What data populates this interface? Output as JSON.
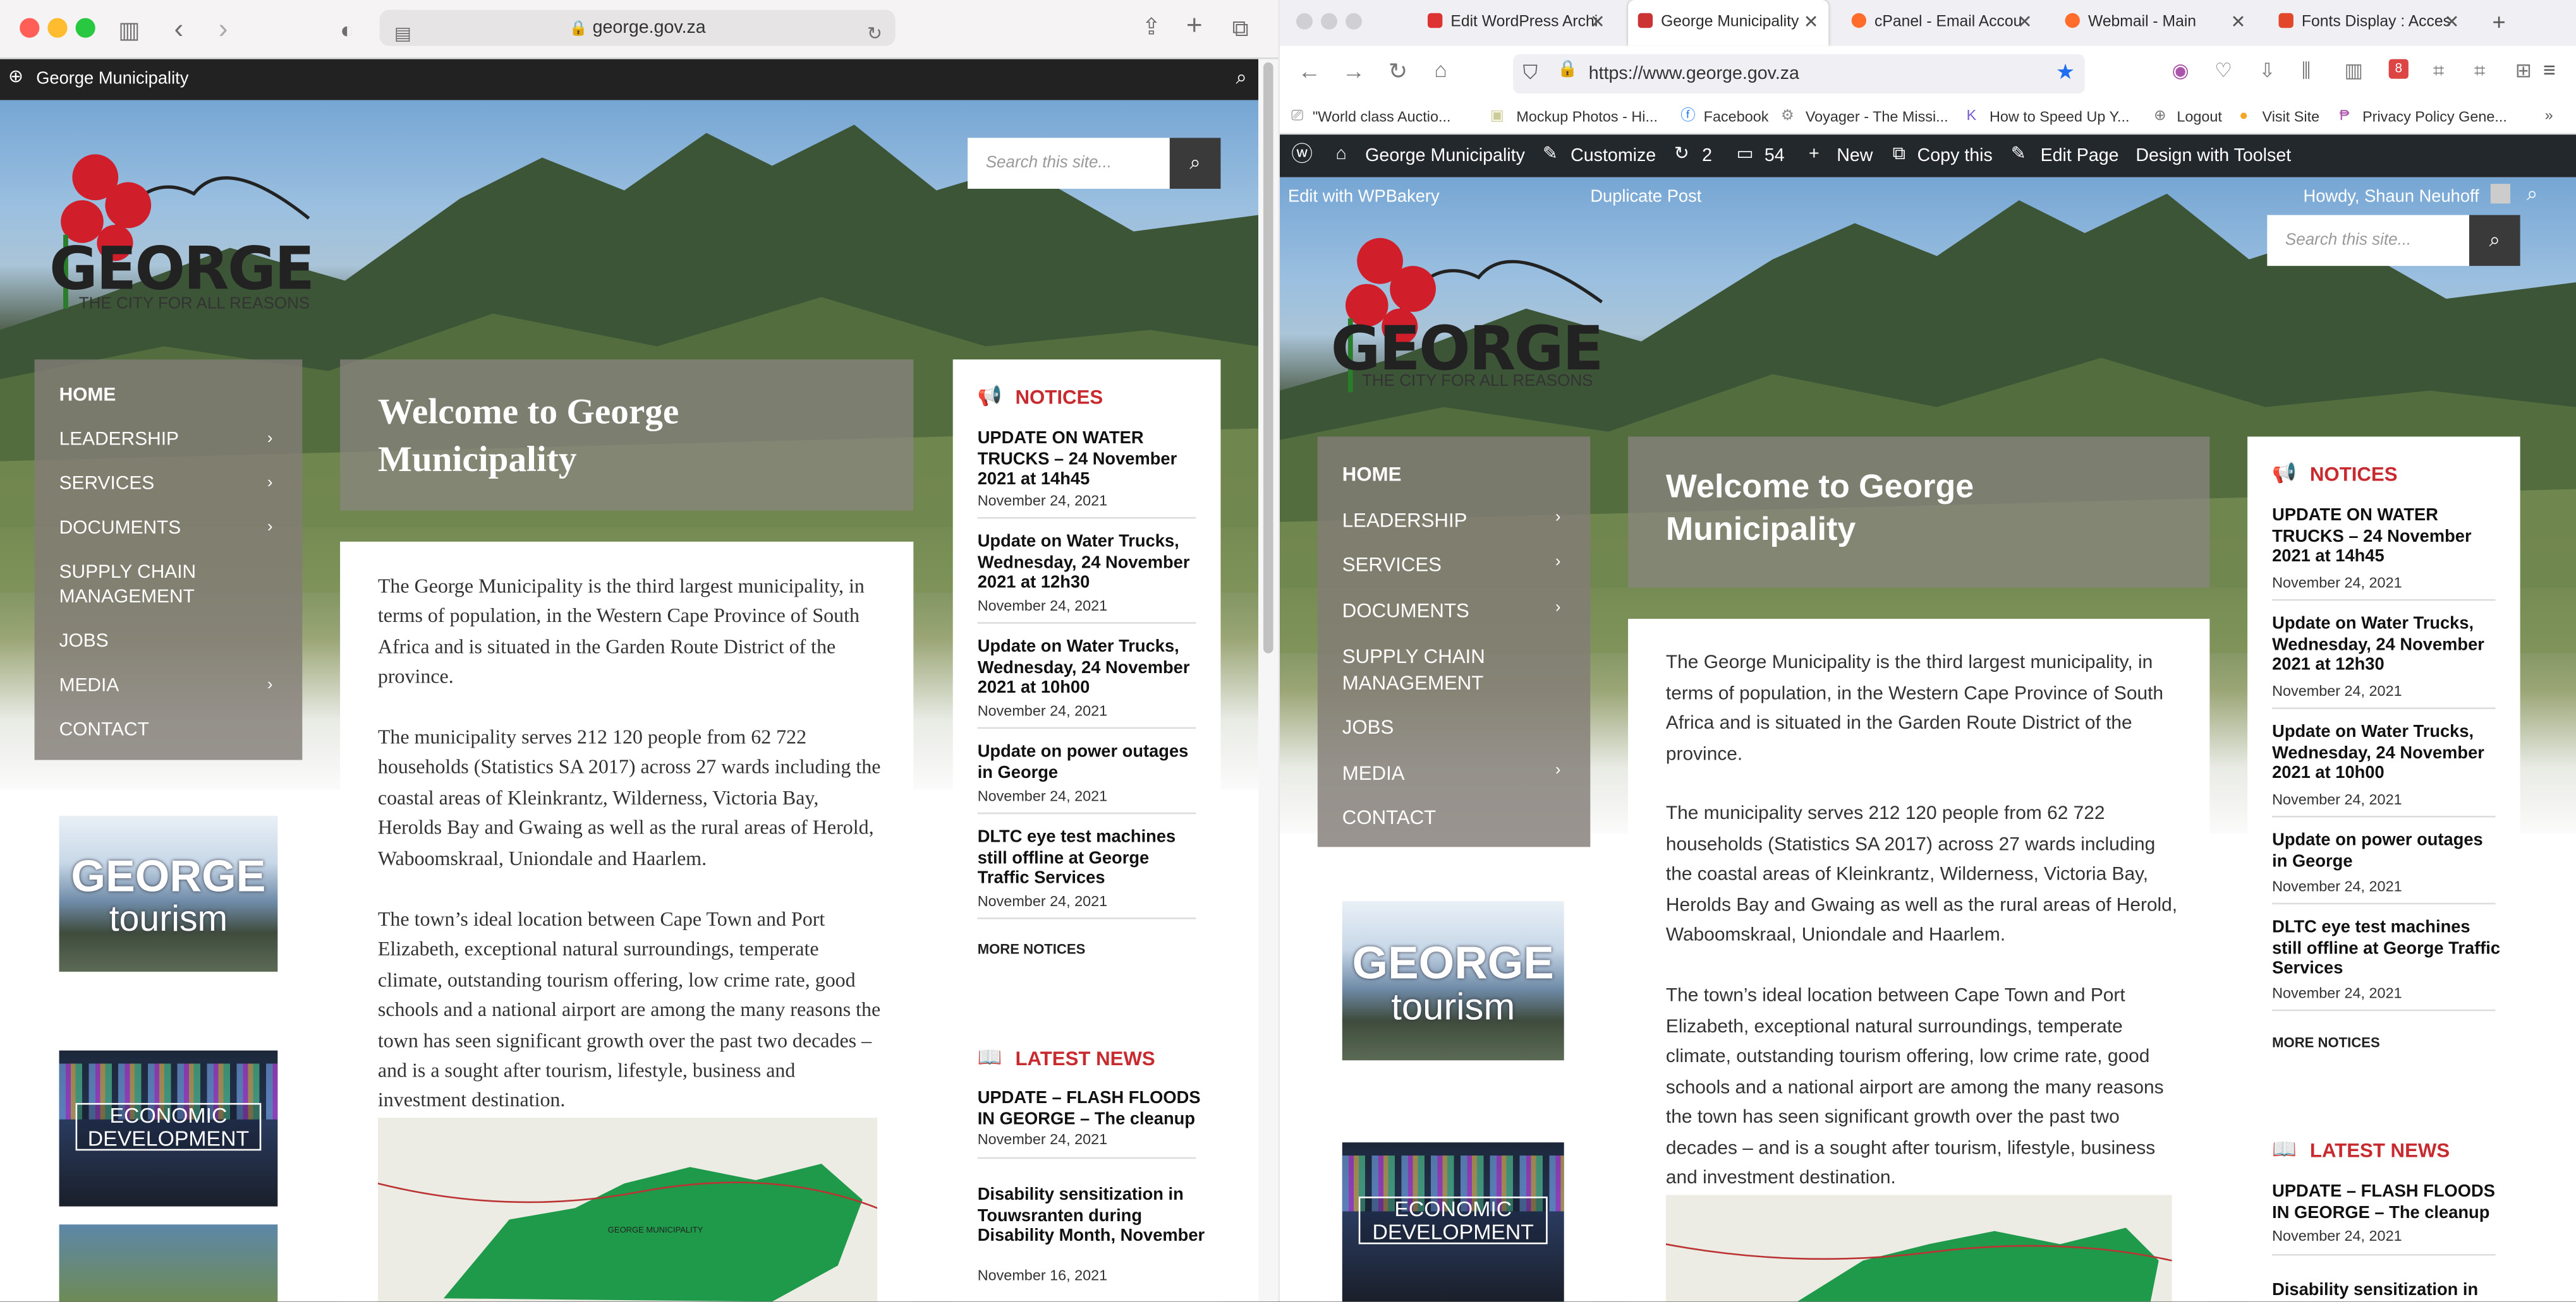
{
  "safari": {
    "url": "george.gov.za"
  },
  "firefox": {
    "tabs": [
      {
        "title": "Edit WordPress Archi",
        "color": "#d33"
      },
      {
        "title": "George Municipality",
        "color": "#c33"
      },
      {
        "title": "cPanel - Email Accou",
        "color": "#ff6c2c"
      },
      {
        "title": "Webmail - Main",
        "color": "#ff6c2c"
      },
      {
        "title": "Fonts Display : Acces",
        "color": "#e2472c"
      }
    ],
    "url": "https://www.george.gov.za",
    "bookmarks": [
      "\"World class Auctio...",
      "Mockup Photos - Hi...",
      "Facebook",
      "Voyager - The Missi...",
      "How to Speed Up Y...",
      "Logout",
      "Visit Site",
      "Privacy Policy Gene..."
    ],
    "badge": "8"
  },
  "wp": {
    "site": "George Municipality",
    "customize": "Customize",
    "updates": "2",
    "comments": "54",
    "new": "New",
    "copy": "Copy this",
    "edit_page": "Edit Page",
    "toolset": "Design with Toolset",
    "wpbakery": "Edit with WPBakery",
    "duplicate": "Duplicate Post",
    "howdy": "Howdy, Shaun Neuhoff"
  },
  "site": {
    "name": "George Municipality",
    "search_placeholder": "Search this site...",
    "logo_text": "GEORGE",
    "tagline": "THE CITY FOR ALL REASONS",
    "nav": [
      {
        "label": "HOME",
        "sub": false
      },
      {
        "label": "LEADERSHIP",
        "sub": true
      },
      {
        "label": "SERVICES",
        "sub": true
      },
      {
        "label": "DOCUMENTS",
        "sub": true
      },
      {
        "label": "SUPPLY CHAIN MANAGEMENT",
        "sub": false
      },
      {
        "label": "JOBS",
        "sub": false
      },
      {
        "label": "MEDIA",
        "sub": true
      },
      {
        "label": "CONTACT",
        "sub": false
      }
    ],
    "welcome_title": "Welcome to George Municipality",
    "paragraphs": [
      "The George Municipality is the third largest municipality, in terms of population, in the Western Cape Province of South Africa and is situated in the Garden Route District of the province.",
      "The municipality serves 212 120 people from 62 722 households (Statistics SA 2017) across 27 wards including the coastal areas of Kleinkrantz, Wilderness, Victoria Bay, Herolds Bay and Gwaing as well as the rural areas of Herold, Waboomskraal, Uniondale and Haarlem.",
      "The town’s ideal location between Cape Town and Port Elizabeth, exceptional natural surroundings, temperate climate, outstanding tourism offering, low crime rate, good schools and a national airport are among the many reasons the town has seen significant growth over the past two decades – and is a sought after tourism, lifestyle, business and investment destination."
    ],
    "map_label": "GEORGE MUNICIPALITY",
    "tourism": [
      "GEORGE",
      "tourism"
    ],
    "economic": [
      "ECONOMIC",
      "DEVELOPMENT"
    ],
    "notices_title": "NOTICES",
    "notices": [
      {
        "title": "UPDATE ON WATER TRUCKS – 24 November 2021 at 14h45",
        "date": "November 24, 2021"
      },
      {
        "title": "Update on Water Trucks, Wednesday, 24 November 2021 at 12h30",
        "date": "November 24, 2021"
      },
      {
        "title": "Update on Water Trucks, Wednesday, 24 November 2021 at 10h00",
        "date": "November 24, 2021"
      },
      {
        "title": "Update on power outages in George",
        "date": "November 24, 2021"
      },
      {
        "title": "DLTC eye test machines still offline at George Traffic Services",
        "date": "November 24, 2021"
      }
    ],
    "more_notices": "MORE NOTICES",
    "news_title": "LATEST NEWS",
    "news": [
      {
        "title": "UPDATE – FLASH FLOODS IN GEORGE – The cleanup",
        "date": "November 24, 2021"
      },
      {
        "title": "Disability sensitization in Touwsranten during Disability Month, November",
        "date": "November 16, 2021"
      }
    ],
    "news_right_partial": "Disability sensitization in"
  }
}
